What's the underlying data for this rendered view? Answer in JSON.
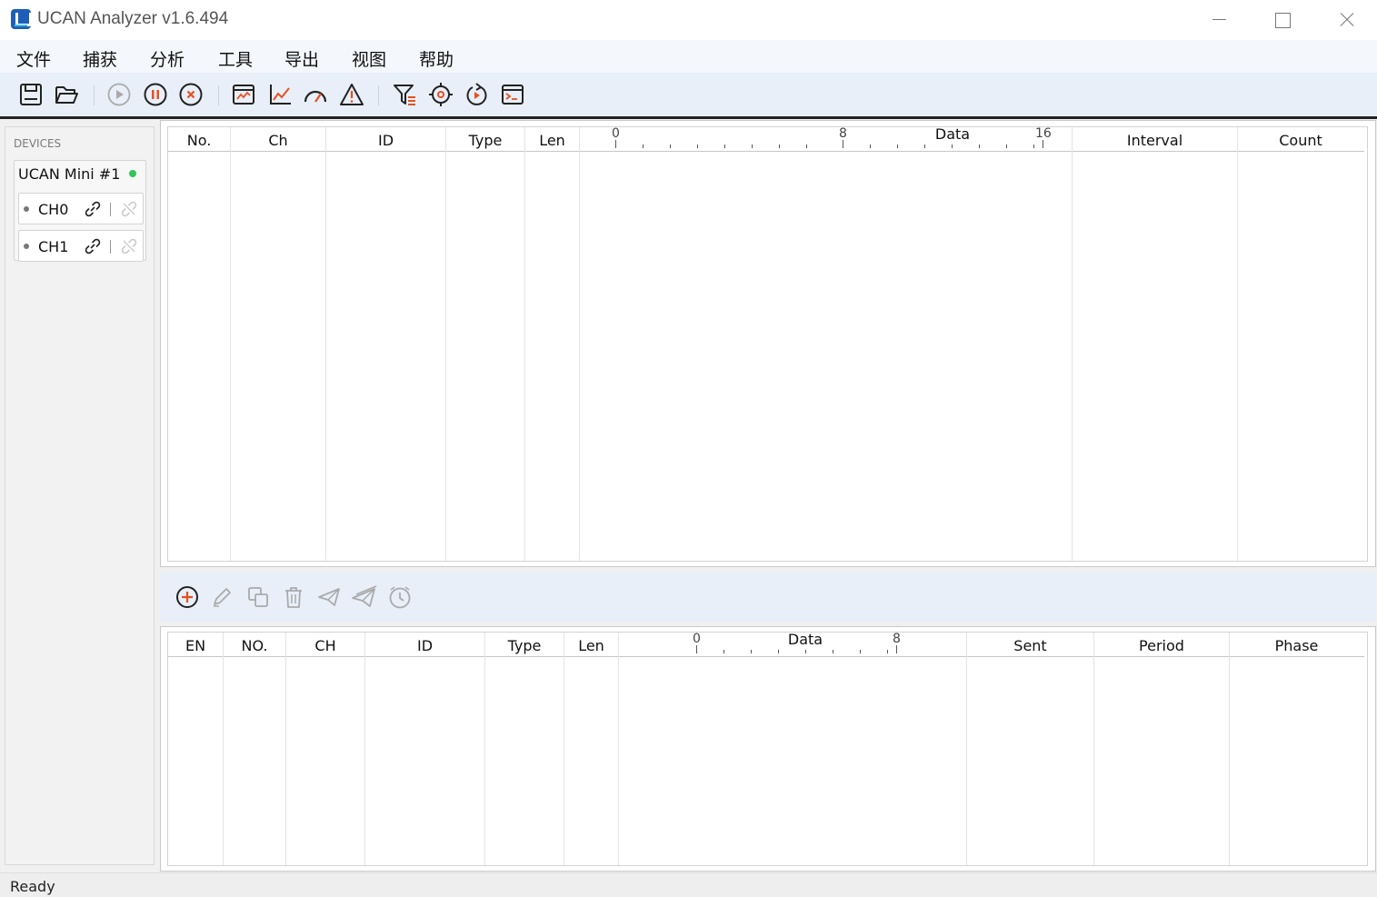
{
  "window": {
    "title": "UCAN Analyzer v1.6.494",
    "icon": "ucan-app-icon"
  },
  "menu": [
    "文件",
    "捕获",
    "分析",
    "工具",
    "导出",
    "视图",
    "帮助"
  ],
  "toolbar": {
    "icons": [
      "save-icon",
      "open-folder-icon",
      "start-icon",
      "pause-icon",
      "stop-icon",
      "trace-window-icon",
      "line-chart-icon",
      "gauge-icon",
      "warning-icon",
      "filter-icon",
      "target-icon",
      "refresh-icon",
      "console-icon"
    ],
    "accent_color": "#e8501e"
  },
  "devices": {
    "label": "DEVICES",
    "device_name": "UCAN Mini #1",
    "status_color": "#33c45a",
    "channels": [
      "CH0",
      "CH1"
    ]
  },
  "receive_table": {
    "columns": [
      "No.",
      "Ch",
      "ID",
      "Type",
      "Len",
      "Data",
      "Interval",
      "Count"
    ],
    "data_ticks": [
      "0",
      "8",
      "16"
    ],
    "rows": []
  },
  "transmit_toolbar": {
    "icons": [
      "add-icon",
      "edit-icon",
      "copy-icon",
      "delete-icon",
      "send-icon",
      "send-all-icon",
      "timer-icon"
    ]
  },
  "transmit_table": {
    "columns": [
      "EN",
      "NO.",
      "CH",
      "ID",
      "Type",
      "Len",
      "Data",
      "Sent",
      "Period",
      "Phase"
    ],
    "data_ticks": [
      "0",
      "8"
    ],
    "rows": []
  },
  "status": "Ready"
}
